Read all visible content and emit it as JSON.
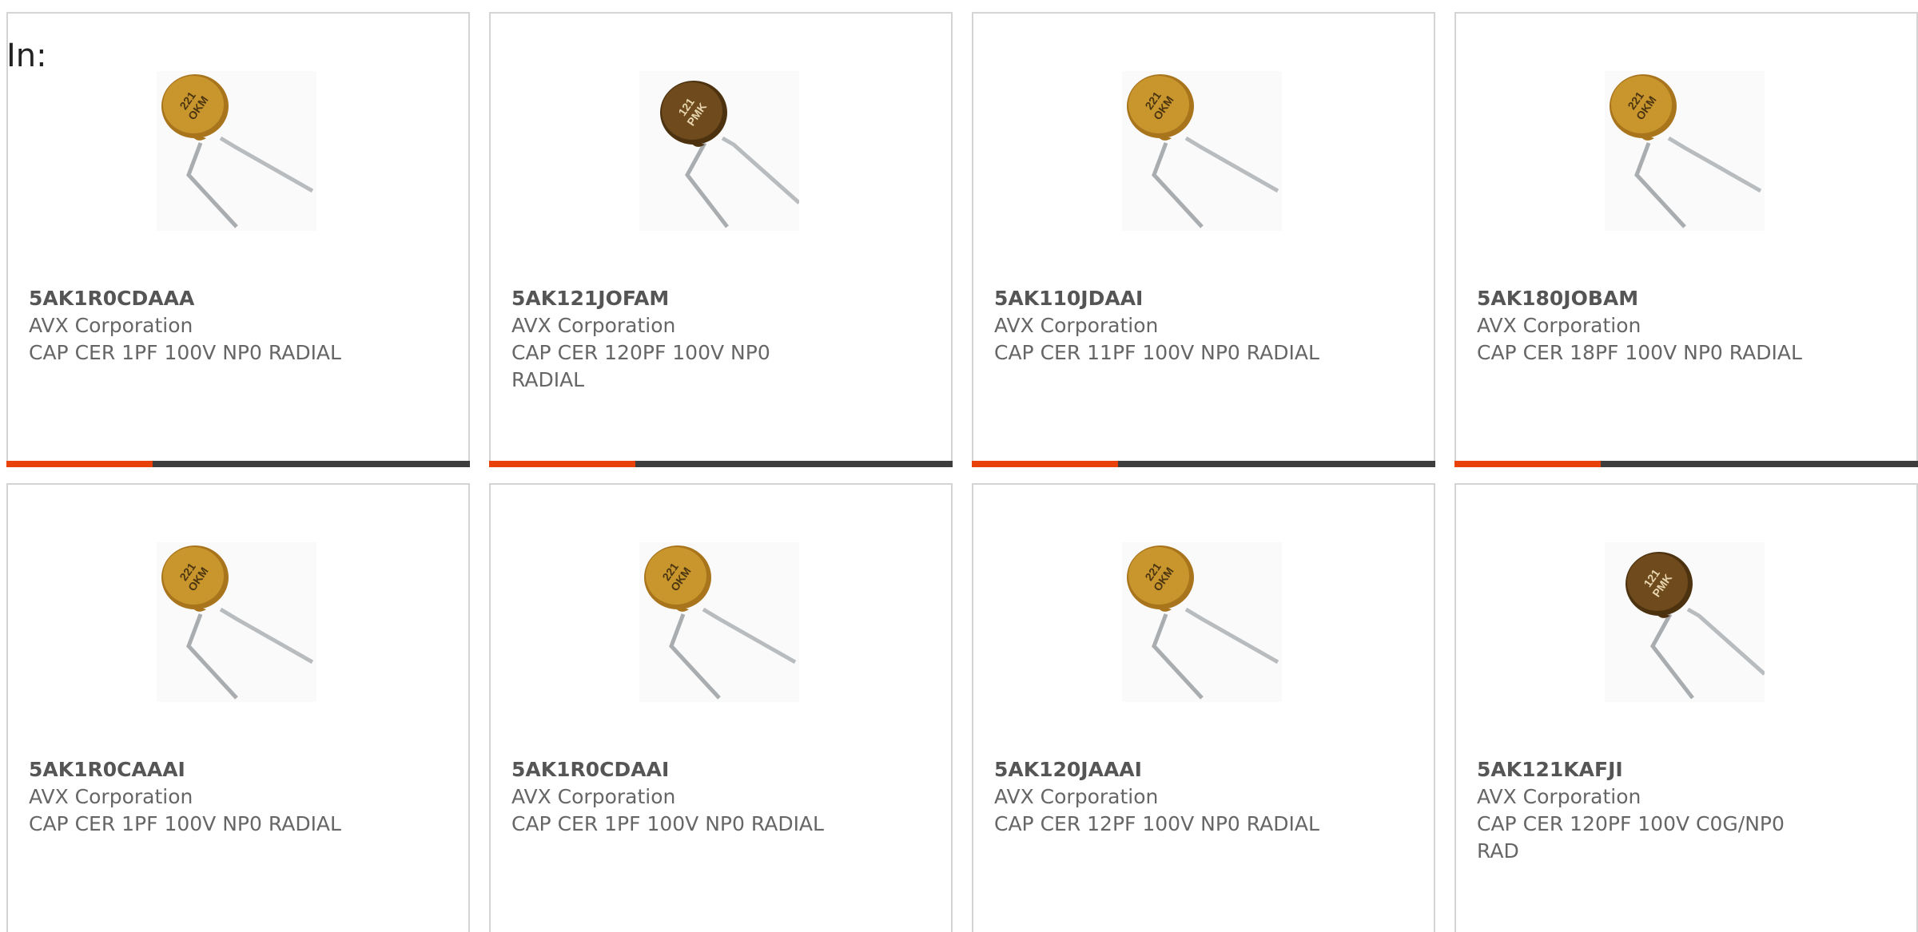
{
  "header": {
    "in_label": "In:"
  },
  "accent_color": "#e8420a",
  "bar_color": "#3d3d3d",
  "products": [
    {
      "part": "5AK1R0CDAAA",
      "manufacturer": "AVX Corporation",
      "description": "CAP CER 1PF 100V NP0 RADIAL",
      "image_icon": "ceramic-disc-capacitor-light-icon",
      "image_marking": "221 OKM"
    },
    {
      "part": "5AK121JOFAM",
      "manufacturer": "AVX Corporation",
      "description": "CAP CER 120PF 100V NP0 RADIAL",
      "image_icon": "ceramic-disc-capacitor-dark-icon",
      "image_marking": "121 PMK"
    },
    {
      "part": "5AK110JDAAI",
      "manufacturer": "AVX Corporation",
      "description": "CAP CER 11PF 100V NP0 RADIAL",
      "image_icon": "ceramic-disc-capacitor-light-icon",
      "image_marking": "221 OKM"
    },
    {
      "part": "5AK180JOBAM",
      "manufacturer": "AVX Corporation",
      "description": "CAP CER 18PF 100V NP0 RADIAL",
      "image_icon": "ceramic-disc-capacitor-light-icon",
      "image_marking": "221 OKM"
    },
    {
      "part": "5AK1R0CAAAI",
      "manufacturer": "AVX Corporation",
      "description": "CAP CER 1PF 100V NP0 RADIAL",
      "image_icon": "ceramic-disc-capacitor-light-icon",
      "image_marking": "221 OKM"
    },
    {
      "part": "5AK1R0CDAAI",
      "manufacturer": "AVX Corporation",
      "description": "CAP CER 1PF 100V NP0 RADIAL",
      "image_icon": "ceramic-disc-capacitor-light-icon",
      "image_marking": "221 OKM"
    },
    {
      "part": "5AK120JAAAI",
      "manufacturer": "AVX Corporation",
      "description": "CAP CER 12PF 100V NP0 RADIAL",
      "image_icon": "ceramic-disc-capacitor-light-icon",
      "image_marking": "221 OKM"
    },
    {
      "part": "5AK121KAFJI",
      "manufacturer": "AVX Corporation",
      "description": "CAP CER 120PF 100V C0G/NP0 RAD",
      "image_icon": "ceramic-disc-capacitor-dark-icon",
      "image_marking": "121 PMK"
    }
  ],
  "card_progress": [
    0.315,
    0.315,
    0.315,
    0.315
  ]
}
